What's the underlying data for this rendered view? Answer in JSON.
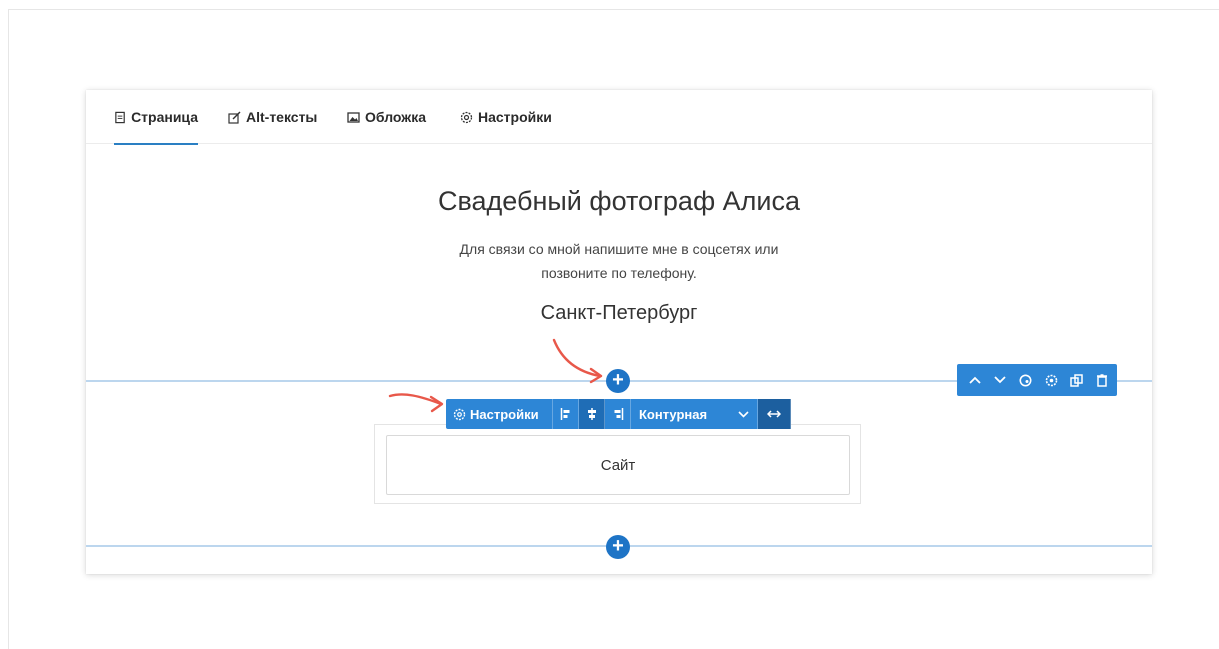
{
  "tabs": [
    {
      "label": "Страница",
      "icon": "page-icon",
      "active": true
    },
    {
      "label": "Alt-тексты",
      "icon": "edit-icon",
      "active": false
    },
    {
      "label": "Обложка",
      "icon": "image-icon",
      "active": false
    },
    {
      "label": "Настройки",
      "icon": "gear-icon",
      "active": false
    }
  ],
  "content": {
    "title": "Свадебный фотограф Алиса",
    "description_line1": "Для связи со мной напишите мне в соцсетях или",
    "description_line2": "позвоните по телефону.",
    "city": "Санкт-Петербург"
  },
  "element_toolbar": {
    "settings_label": "Настройки",
    "style_label": "Контурная",
    "align_left_icon": "align-left-icon",
    "align_center_icon": "align-center-icon",
    "align_right_icon": "align-right-icon",
    "width_icon": "expand-width-icon"
  },
  "block_toolbar": {
    "icons": [
      "chevron-up-icon",
      "chevron-down-icon",
      "palette-icon",
      "gear-icon",
      "duplicate-icon",
      "trash-icon"
    ]
  },
  "button_element": {
    "label": "Сайт"
  },
  "colors": {
    "accent": "#2d86d6",
    "plus": "#1e74c6",
    "annotation_arrow": "#e8584a",
    "divider": "#bcd6ee"
  }
}
